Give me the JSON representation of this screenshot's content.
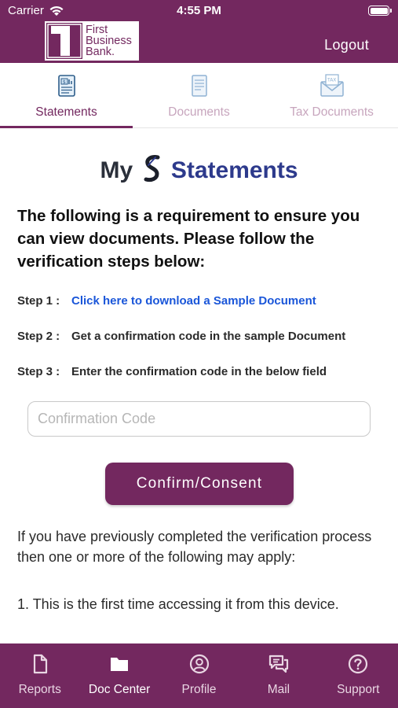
{
  "status_bar": {
    "carrier": "Carrier",
    "time": "4:55 PM"
  },
  "header": {
    "logo_line1": "First",
    "logo_line2": "Business",
    "logo_line3": "Bank.",
    "logout_label": "Logout"
  },
  "tabs": [
    {
      "label": "Statements",
      "icon": "statement-icon",
      "active": true
    },
    {
      "label": "Documents",
      "icon": "document-icon",
      "active": false
    },
    {
      "label": "Tax Documents",
      "icon": "tax-envelope-icon",
      "active": false
    }
  ],
  "brand": {
    "my": "My",
    "name": "Statements"
  },
  "intro": "The following is a requirement to ensure you can view documents. Please follow the verification steps below:",
  "steps": [
    {
      "number": "Step 1 :",
      "text": "Click here to download a Sample Document",
      "is_link": true
    },
    {
      "number": "Step 2 :",
      "text": "Get a confirmation code in the sample Document",
      "is_link": false
    },
    {
      "number": "Step 3 :",
      "text": "Enter the confirmation code in the below field",
      "is_link": false
    }
  ],
  "confirmation_input": {
    "placeholder": "Confirmation Code",
    "value": ""
  },
  "confirm_button": "Confirm/Consent",
  "note": "If you have previously completed the verification process then one or more of the following may apply:",
  "note_items": [
    "1. This is the first time accessing it from this device."
  ],
  "bottom_nav": [
    {
      "label": "Reports",
      "icon": "document-icon",
      "active": false
    },
    {
      "label": "Doc Center",
      "icon": "folder-icon",
      "active": true
    },
    {
      "label": "Profile",
      "icon": "user-circle-icon",
      "active": false
    },
    {
      "label": "Mail",
      "icon": "chat-bubbles-icon",
      "active": false
    },
    {
      "label": "Support",
      "icon": "help-circle-icon",
      "active": false
    }
  ],
  "colors": {
    "primary": "#73285f",
    "link": "#1a56d9",
    "brand_blue": "#2d3a8c",
    "tab_inactive": "#c7a5bd"
  }
}
